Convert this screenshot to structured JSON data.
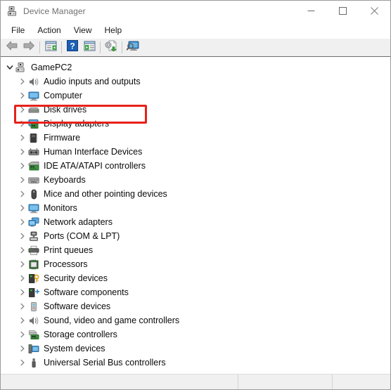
{
  "window": {
    "title": "Device Manager",
    "icon": "device-manager-icon",
    "controls": [
      {
        "name": "minimize-button",
        "glyph": "minimize"
      },
      {
        "name": "maximize-button",
        "glyph": "maximize"
      },
      {
        "name": "close-button",
        "glyph": "close"
      }
    ]
  },
  "menubar": {
    "items": [
      {
        "label": "File",
        "name": "menu-file"
      },
      {
        "label": "Action",
        "name": "menu-action"
      },
      {
        "label": "View",
        "name": "menu-view"
      },
      {
        "label": "Help",
        "name": "menu-help"
      }
    ]
  },
  "toolbar": {
    "buttons": [
      {
        "name": "back-button",
        "icon": "back-arrow-icon"
      },
      {
        "name": "forward-button",
        "icon": "forward-arrow-icon"
      },
      {
        "name": "separator-1",
        "icon": "separator"
      },
      {
        "name": "show-hide-console-tree-button",
        "icon": "console-tree-icon"
      },
      {
        "name": "separator-2",
        "icon": "separator"
      },
      {
        "name": "help-button",
        "icon": "question-mark-icon"
      },
      {
        "name": "properties-button",
        "icon": "properties-window-icon"
      },
      {
        "name": "separator-3",
        "icon": "separator"
      },
      {
        "name": "update-driver-button",
        "icon": "update-driver-icon"
      },
      {
        "name": "separator-4",
        "icon": "separator"
      },
      {
        "name": "scan-hardware-changes-button",
        "icon": "scan-monitor-icon"
      }
    ]
  },
  "tree": {
    "root": {
      "label": "GamePC2",
      "icon": "computer-root-icon",
      "expanded": true,
      "chevron": "chevron-down-icon"
    },
    "items": [
      {
        "label": "Audio inputs and outputs",
        "icon": "speaker-icon",
        "chevron": "chevron-right-icon",
        "highlighted": false
      },
      {
        "label": "Computer",
        "icon": "monitor-icon",
        "chevron": "chevron-right-icon",
        "highlighted": false
      },
      {
        "label": "Disk drives",
        "icon": "disk-drive-icon",
        "chevron": "chevron-right-icon",
        "highlighted": false
      },
      {
        "label": "Display adapters",
        "icon": "display-adapter-icon",
        "chevron": "chevron-right-icon",
        "highlighted": true
      },
      {
        "label": "Firmware",
        "icon": "firmware-chip-icon",
        "chevron": "chevron-right-icon",
        "highlighted": false
      },
      {
        "label": "Human Interface Devices",
        "icon": "hid-icon",
        "chevron": "chevron-right-icon",
        "highlighted": false
      },
      {
        "label": "IDE ATA/ATAPI controllers",
        "icon": "ide-controller-icon",
        "chevron": "chevron-right-icon",
        "highlighted": false
      },
      {
        "label": "Keyboards",
        "icon": "keyboard-icon",
        "chevron": "chevron-right-icon",
        "highlighted": false
      },
      {
        "label": "Mice and other pointing devices",
        "icon": "mouse-icon",
        "chevron": "chevron-right-icon",
        "highlighted": false
      },
      {
        "label": "Monitors",
        "icon": "monitor-icon",
        "chevron": "chevron-right-icon",
        "highlighted": false
      },
      {
        "label": "Network adapters",
        "icon": "network-adapter-icon",
        "chevron": "chevron-right-icon",
        "highlighted": false
      },
      {
        "label": "Ports (COM & LPT)",
        "icon": "port-icon",
        "chevron": "chevron-right-icon",
        "highlighted": false
      },
      {
        "label": "Print queues",
        "icon": "printer-icon",
        "chevron": "chevron-right-icon",
        "highlighted": false
      },
      {
        "label": "Processors",
        "icon": "processor-icon",
        "chevron": "chevron-right-icon",
        "highlighted": false
      },
      {
        "label": "Security devices",
        "icon": "security-key-icon",
        "chevron": "chevron-right-icon",
        "highlighted": false
      },
      {
        "label": "Software components",
        "icon": "software-component-icon",
        "chevron": "chevron-right-icon",
        "highlighted": false
      },
      {
        "label": "Software devices",
        "icon": "software-device-icon",
        "chevron": "chevron-right-icon",
        "highlighted": false
      },
      {
        "label": "Sound, video and game controllers",
        "icon": "speaker-icon",
        "chevron": "chevron-right-icon",
        "highlighted": false
      },
      {
        "label": "Storage controllers",
        "icon": "storage-controller-icon",
        "chevron": "chevron-right-icon",
        "highlighted": false
      },
      {
        "label": "System devices",
        "icon": "system-device-icon",
        "chevron": "chevron-right-icon",
        "highlighted": false
      },
      {
        "label": "Universal Serial Bus controllers",
        "icon": "usb-icon",
        "chevron": "chevron-right-icon",
        "highlighted": false
      }
    ]
  },
  "annotation": {
    "color": "#e8211a",
    "target_label": "Display adapters"
  },
  "statusbar": {
    "panes": [
      "",
      "",
      ""
    ]
  }
}
